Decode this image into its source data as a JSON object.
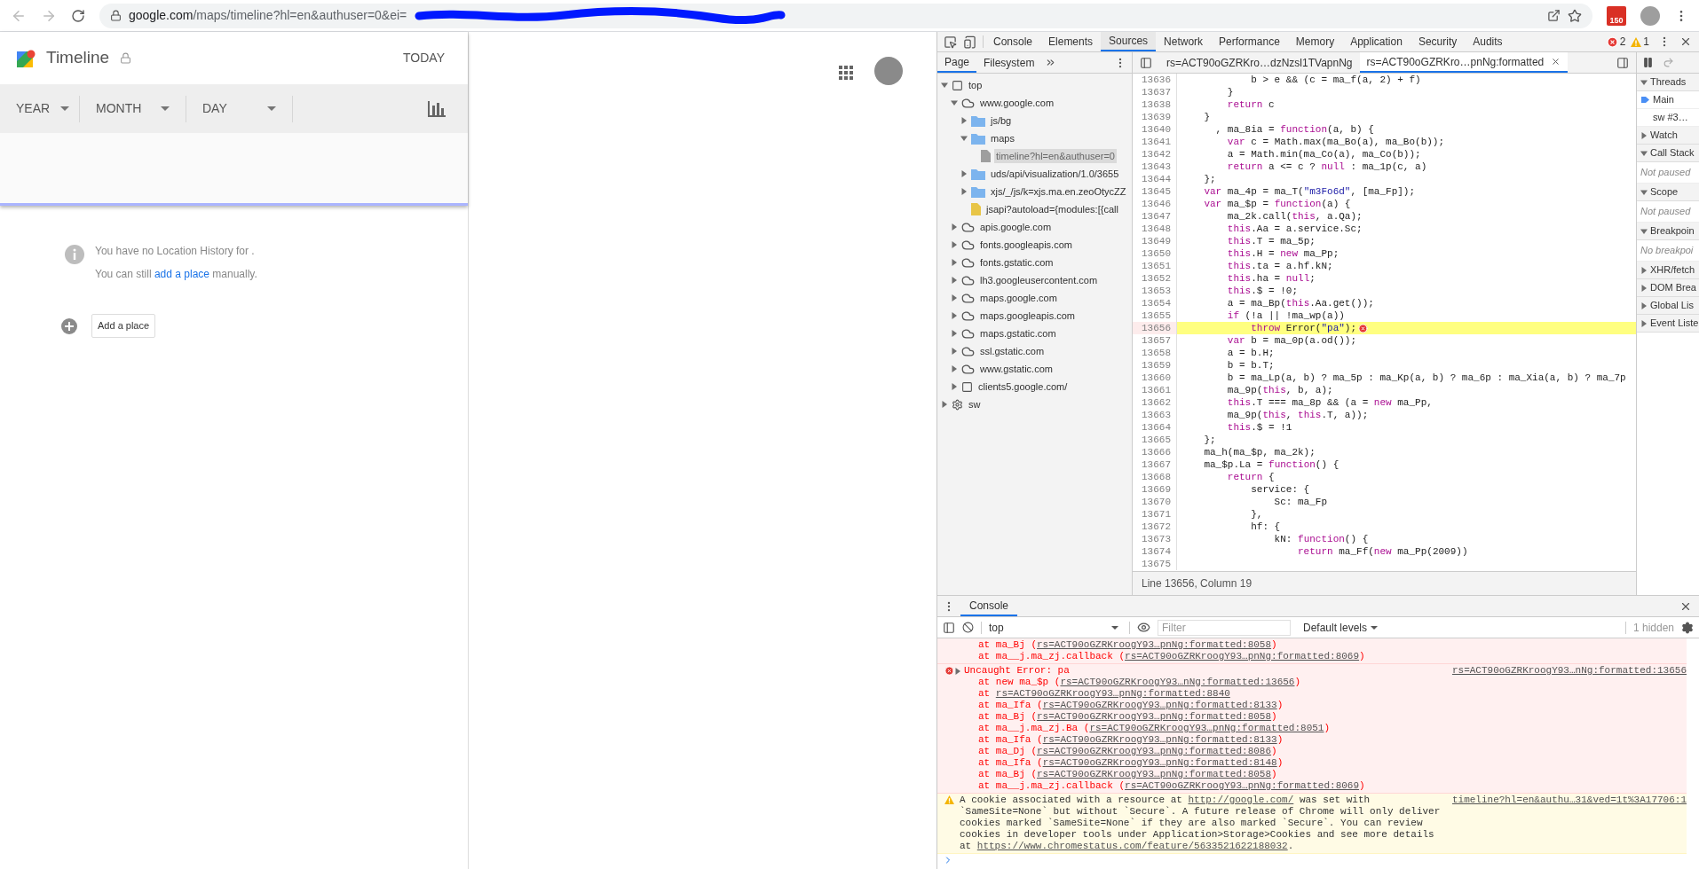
{
  "browser": {
    "url_host": "google.com",
    "url_path": "/maps/timeline?hl=en&authuser=0&ei=",
    "extension_badge": "150"
  },
  "timeline": {
    "title": "Timeline",
    "today_button": "TODAY",
    "filters": [
      {
        "label": "YEAR"
      },
      {
        "label": "MONTH"
      },
      {
        "label": "DAY"
      }
    ],
    "empty_message": "You have no Location History for .",
    "hint": {
      "before": "You can still ",
      "link": "add a place",
      "after": " manually."
    },
    "add_button": "Add a place"
  },
  "devtools": {
    "tabs": [
      {
        "label": "Console",
        "selected": false
      },
      {
        "label": "Elements",
        "selected": false
      },
      {
        "label": "Sources",
        "selected": true
      },
      {
        "label": "Network",
        "selected": false
      },
      {
        "label": "Performance",
        "selected": false
      },
      {
        "label": "Memory",
        "selected": false
      },
      {
        "label": "Application",
        "selected": false
      },
      {
        "label": "Security",
        "selected": false
      },
      {
        "label": "Audits",
        "selected": false
      }
    ],
    "error_count": "2",
    "warning_count": "1",
    "sources": {
      "navigator_tabs": [
        {
          "label": "Page",
          "selected": true
        },
        {
          "label": "Filesystem",
          "selected": false
        }
      ],
      "tree": [
        {
          "label": "top",
          "kind": "frame",
          "expanded": true,
          "selected": false,
          "children": [
            {
              "label": "www.google.com",
              "kind": "cloud",
              "expanded": true,
              "selected": false,
              "children": [
                {
                  "label": "js/bg",
                  "kind": "folder",
                  "expanded": false,
                  "selected": false
                },
                {
                  "label": "maps",
                  "kind": "folder",
                  "expanded": true,
                  "selected": false,
                  "children": [
                    {
                      "label": "timeline?hl=en&authuser=0",
                      "kind": "document",
                      "selected": true
                    }
                  ]
                },
                {
                  "label": "uds/api/visualization/1.0/3655",
                  "kind": "folder",
                  "expanded": false,
                  "selected": false
                },
                {
                  "label": "xjs/_/js/k=xjs.ma.en.zeoOtycZZ",
                  "kind": "folder",
                  "expanded": false,
                  "selected": false
                },
                {
                  "label": "jsapi?autoload={modules:[{call",
                  "kind": "script",
                  "selected": false
                }
              ]
            },
            {
              "label": "apis.google.com",
              "kind": "cloud",
              "expanded": false,
              "selected": false
            },
            {
              "label": "fonts.googleapis.com",
              "kind": "cloud",
              "expanded": false,
              "selected": false
            },
            {
              "label": "fonts.gstatic.com",
              "kind": "cloud",
              "expanded": false,
              "selected": false
            },
            {
              "label": "lh3.googleusercontent.com",
              "kind": "cloud",
              "expanded": false,
              "selected": false
            },
            {
              "label": "maps.google.com",
              "kind": "cloud",
              "expanded": false,
              "selected": false
            },
            {
              "label": "maps.googleapis.com",
              "kind": "cloud",
              "expanded": false,
              "selected": false
            },
            {
              "label": "maps.gstatic.com",
              "kind": "cloud",
              "expanded": false,
              "selected": false
            },
            {
              "label": "ssl.gstatic.com",
              "kind": "cloud",
              "expanded": false,
              "selected": false
            },
            {
              "label": "www.gstatic.com",
              "kind": "cloud",
              "expanded": false,
              "selected": false
            },
            {
              "label": "clients5.google.com/",
              "kind": "frame",
              "expanded": false,
              "selected": false
            }
          ]
        },
        {
          "label": "sw",
          "kind": "gear",
          "expanded": false,
          "selected": false
        }
      ],
      "editor_tabs": [
        {
          "label": "rs=ACT90oGZRKro…dzNzsl1TVapnNg",
          "selected": false
        },
        {
          "label": "rs=ACT90oGZRKro…pnNg:formatted",
          "selected": true
        }
      ],
      "lines": [
        {
          "number": "13636",
          "highlighted": false,
          "tokens": [
            {
              "kind": "plain",
              "text": "            b > e && (c = ma_f(a, 2) + f)"
            }
          ]
        },
        {
          "number": "13637",
          "highlighted": false,
          "tokens": [
            {
              "kind": "plain",
              "text": "        }"
            }
          ]
        },
        {
          "number": "13638",
          "highlighted": false,
          "tokens": [
            {
              "kind": "keyword",
              "text": "        return"
            },
            {
              "kind": "plain",
              "text": " c"
            }
          ]
        },
        {
          "number": "13639",
          "highlighted": false,
          "tokens": [
            {
              "kind": "plain",
              "text": "    }"
            }
          ]
        },
        {
          "number": "13640",
          "highlighted": false,
          "tokens": [
            {
              "kind": "plain",
              "text": "      , ma_8ia = "
            },
            {
              "kind": "keyword",
              "text": "function"
            },
            {
              "kind": "plain",
              "text": "(a, b) {"
            }
          ]
        },
        {
          "number": "13641",
          "highlighted": false,
          "tokens": [
            {
              "kind": "keyword",
              "text": "        var"
            },
            {
              "kind": "plain",
              "text": " c = Math.max(ma_Bo(a), ma_Bo(b));"
            }
          ]
        },
        {
          "number": "13642",
          "highlighted": false,
          "tokens": [
            {
              "kind": "plain",
              "text": "        a = Math.min(ma_Co(a), ma_Co(b));"
            }
          ]
        },
        {
          "number": "13643",
          "highlighted": false,
          "tokens": [
            {
              "kind": "keyword",
              "text": "        return"
            },
            {
              "kind": "plain",
              "text": " a <= c ? "
            },
            {
              "kind": "keyword",
              "text": "null"
            },
            {
              "kind": "plain",
              "text": " : ma_1p(c, a)"
            }
          ]
        },
        {
          "number": "13644",
          "highlighted": false,
          "tokens": [
            {
              "kind": "plain",
              "text": "    };"
            }
          ]
        },
        {
          "number": "13645",
          "highlighted": false,
          "tokens": [
            {
              "kind": "keyword",
              "text": "    var"
            },
            {
              "kind": "plain",
              "text": " ma_4p = ma_T("
            },
            {
              "kind": "string",
              "text": "\"m3Fo6d\""
            },
            {
              "kind": "plain",
              "text": ", [ma_Fp]);"
            }
          ]
        },
        {
          "number": "13646",
          "highlighted": false,
          "tokens": [
            {
              "kind": "keyword",
              "text": "    var"
            },
            {
              "kind": "plain",
              "text": " ma_$p = "
            },
            {
              "kind": "keyword",
              "text": "function"
            },
            {
              "kind": "plain",
              "text": "(a) {"
            }
          ]
        },
        {
          "number": "13647",
          "highlighted": false,
          "tokens": [
            {
              "kind": "plain",
              "text": "        ma_2k.call("
            },
            {
              "kind": "keyword",
              "text": "this"
            },
            {
              "kind": "plain",
              "text": ", a.Qa);"
            }
          ]
        },
        {
          "number": "13648",
          "highlighted": false,
          "tokens": [
            {
              "kind": "keyword",
              "text": "        this"
            },
            {
              "kind": "plain",
              "text": ".Aa = a.service.Sc;"
            }
          ]
        },
        {
          "number": "13649",
          "highlighted": false,
          "tokens": [
            {
              "kind": "keyword",
              "text": "        this"
            },
            {
              "kind": "plain",
              "text": ".T = ma_5p;"
            }
          ]
        },
        {
          "number": "13650",
          "highlighted": false,
          "tokens": [
            {
              "kind": "keyword",
              "text": "        this"
            },
            {
              "kind": "plain",
              "text": ".H = "
            },
            {
              "kind": "keyword",
              "text": "new"
            },
            {
              "kind": "plain",
              "text": " ma_Pp;"
            }
          ]
        },
        {
          "number": "13651",
          "highlighted": false,
          "tokens": [
            {
              "kind": "keyword",
              "text": "        this"
            },
            {
              "kind": "plain",
              "text": ".ta = a.hf.kN;"
            }
          ]
        },
        {
          "number": "13652",
          "highlighted": false,
          "tokens": [
            {
              "kind": "keyword",
              "text": "        this"
            },
            {
              "kind": "plain",
              "text": ".ha = "
            },
            {
              "kind": "keyword",
              "text": "null"
            },
            {
              "kind": "plain",
              "text": ";"
            }
          ]
        },
        {
          "number": "13653",
          "highlighted": false,
          "tokens": [
            {
              "kind": "keyword",
              "text": "        this"
            },
            {
              "kind": "plain",
              "text": ".$ = !0;"
            }
          ]
        },
        {
          "number": "13654",
          "highlighted": false,
          "tokens": [
            {
              "kind": "plain",
              "text": "        a = ma_Bp("
            },
            {
              "kind": "keyword",
              "text": "this"
            },
            {
              "kind": "plain",
              "text": ".Aa.get());"
            }
          ]
        },
        {
          "number": "13655",
          "highlighted": false,
          "tokens": [
            {
              "kind": "keyword",
              "text": "        if"
            },
            {
              "kind": "plain",
              "text": " (!a || !ma_wp(a))"
            }
          ]
        },
        {
          "number": "13656",
          "highlighted": true,
          "tokens": [
            {
              "kind": "keyword",
              "text": "            throw"
            },
            {
              "kind": "plain",
              "text": " Error("
            },
            {
              "kind": "string",
              "text": "\"pa\""
            },
            {
              "kind": "plain",
              "text": ");"
            }
          ]
        },
        {
          "number": "13657",
          "highlighted": false,
          "tokens": [
            {
              "kind": "keyword",
              "text": "        var"
            },
            {
              "kind": "plain",
              "text": " b = ma_0p(a.od());"
            }
          ]
        },
        {
          "number": "13658",
          "highlighted": false,
          "tokens": [
            {
              "kind": "plain",
              "text": "        a = b.H;"
            }
          ]
        },
        {
          "number": "13659",
          "highlighted": false,
          "tokens": [
            {
              "kind": "plain",
              "text": "        b = b.T;"
            }
          ]
        },
        {
          "number": "13660",
          "highlighted": false,
          "tokens": [
            {
              "kind": "plain",
              "text": "        b = ma_Lp(a, b) ? ma_5p : ma_Kp(a, b) ? ma_6p : ma_Xia(a, b) ? ma_7p"
            }
          ]
        },
        {
          "number": "13661",
          "highlighted": false,
          "tokens": [
            {
              "kind": "plain",
              "text": "        ma_9p("
            },
            {
              "kind": "keyword",
              "text": "this"
            },
            {
              "kind": "plain",
              "text": ", b, a);"
            }
          ]
        },
        {
          "number": "13662",
          "highlighted": false,
          "tokens": [
            {
              "kind": "keyword",
              "text": "        this"
            },
            {
              "kind": "plain",
              "text": ".T === ma_8p && (a = "
            },
            {
              "kind": "keyword",
              "text": "new"
            },
            {
              "kind": "plain",
              "text": " ma_Pp,"
            }
          ]
        },
        {
          "number": "13663",
          "highlighted": false,
          "tokens": [
            {
              "kind": "plain",
              "text": "        ma_9p("
            },
            {
              "kind": "keyword",
              "text": "this"
            },
            {
              "kind": "plain",
              "text": ", "
            },
            {
              "kind": "keyword",
              "text": "this"
            },
            {
              "kind": "plain",
              "text": ".T, a));"
            }
          ]
        },
        {
          "number": "13664",
          "highlighted": false,
          "tokens": [
            {
              "kind": "keyword",
              "text": "        this"
            },
            {
              "kind": "plain",
              "text": ".$ = !1"
            }
          ]
        },
        {
          "number": "13665",
          "highlighted": false,
          "tokens": [
            {
              "kind": "plain",
              "text": "    };"
            }
          ]
        },
        {
          "number": "13666",
          "highlighted": false,
          "tokens": [
            {
              "kind": "plain",
              "text": "    ma_h(ma_$p, ma_2k);"
            }
          ]
        },
        {
          "number": "13667",
          "highlighted": false,
          "tokens": [
            {
              "kind": "plain",
              "text": "    ma_$p.La = "
            },
            {
              "kind": "keyword",
              "text": "function"
            },
            {
              "kind": "plain",
              "text": "() {"
            }
          ]
        },
        {
          "number": "13668",
          "highlighted": false,
          "tokens": [
            {
              "kind": "keyword",
              "text": "        return"
            },
            {
              "kind": "plain",
              "text": " {"
            }
          ]
        },
        {
          "number": "13669",
          "highlighted": false,
          "tokens": [
            {
              "kind": "plain",
              "text": "            service: {"
            }
          ]
        },
        {
          "number": "13670",
          "highlighted": false,
          "tokens": [
            {
              "kind": "plain",
              "text": "                Sc: ma_Fp"
            }
          ]
        },
        {
          "number": "13671",
          "highlighted": false,
          "tokens": [
            {
              "kind": "plain",
              "text": "            },"
            }
          ]
        },
        {
          "number": "13672",
          "highlighted": false,
          "tokens": [
            {
              "kind": "plain",
              "text": "            hf: {"
            }
          ]
        },
        {
          "number": "13673",
          "highlighted": false,
          "tokens": [
            {
              "kind": "plain",
              "text": "                kN: "
            },
            {
              "kind": "keyword",
              "text": "function"
            },
            {
              "kind": "plain",
              "text": "() {"
            }
          ]
        },
        {
          "number": "13674",
          "highlighted": false,
          "tokens": [
            {
              "kind": "keyword",
              "text": "                    return"
            },
            {
              "kind": "plain",
              "text": " ma_Ff("
            },
            {
              "kind": "keyword",
              "text": "new"
            },
            {
              "kind": "plain",
              "text": " ma_Pp(2009))"
            }
          ]
        },
        {
          "number": "13675",
          "highlighted": false
        }
      ],
      "status": "Line 13656, Column 19",
      "debugger": [
        {
          "title": "Threads",
          "expanded": true,
          "threads": [
            {
              "label": "Main",
              "selected": true
            },
            {
              "label": "sw #3…",
              "selected": false
            }
          ]
        },
        {
          "title": "Watch",
          "expanded": false
        },
        {
          "title": "Call Stack",
          "expanded": true,
          "message": "Not paused"
        },
        {
          "title": "Scope",
          "expanded": true,
          "message": "Not paused"
        },
        {
          "title": "Breakpoin",
          "expanded": true,
          "message": "No breakpoi"
        },
        {
          "title": "XHR/fetch",
          "expanded": false
        },
        {
          "title": "DOM Brea",
          "expanded": false
        },
        {
          "title": "Global Lis",
          "expanded": false
        },
        {
          "title": "Event Liste",
          "expanded": false
        }
      ]
    },
    "console": {
      "tabs": [
        {
          "label": "Console",
          "selected": true
        }
      ],
      "context": "top",
      "filter_placeholder": "Filter",
      "levels": "Default levels",
      "hidden": "1 hidden",
      "messages": [
        {
          "kind": "error-tail",
          "frames": [
            {
              "prefix": "at ma_Bj (",
              "link": "rs=ACT90oGZRKroogY93…pnNg:formatted:8058",
              "suffix": ")"
            },
            {
              "prefix": "at ma__j.ma_zj.callback (",
              "link": "rs=ACT90oGZRKroogY93…pnNg:formatted:8069",
              "suffix": ")"
            }
          ]
        },
        {
          "kind": "error",
          "text": "Uncaught Error: pa",
          "source": "rs=ACT90oGZRKroogY93…nNg:formatted:13656",
          "frames": [
            {
              "prefix": "at new ma_$p (",
              "link": "rs=ACT90oGZRKroogY93…nNg:formatted:13656",
              "suffix": ")"
            },
            {
              "prefix": "at ",
              "link": "rs=ACT90oGZRKroogY93…pnNg:formatted:8840"
            },
            {
              "prefix": "at ma_Ifa (",
              "link": "rs=ACT90oGZRKroogY93…pnNg:formatted:8133",
              "suffix": ")"
            },
            {
              "prefix": "at ma_Bj (",
              "link": "rs=ACT90oGZRKroogY93…pnNg:formatted:8058",
              "suffix": ")"
            },
            {
              "prefix": "at ma__j.ma_zj.Ba (",
              "link": "rs=ACT90oGZRKroogY93…pnNg:formatted:8051",
              "suffix": ")"
            },
            {
              "prefix": "at ma_Ifa (",
              "link": "rs=ACT90oGZRKroogY93…pnNg:formatted:8133",
              "suffix": ")"
            },
            {
              "prefix": "at ma_Dj (",
              "link": "rs=ACT90oGZRKroogY93…pnNg:formatted:8086",
              "suffix": ")"
            },
            {
              "prefix": "at ma_Ifa (",
              "link": "rs=ACT90oGZRKroogY93…pnNg:formatted:8148",
              "suffix": ")"
            },
            {
              "prefix": "at ma_Bj (",
              "link": "rs=ACT90oGZRKroogY93…pnNg:formatted:8058",
              "suffix": ")"
            },
            {
              "prefix": "at ma__j.ma_zj.callback (",
              "link": "rs=ACT90oGZRKroogY93…pnNg:formatted:8069",
              "suffix": ")"
            }
          ]
        },
        {
          "kind": "warning",
          "source": "timeline?hl=en&authu…31&ved=1t%3A17706:1",
          "parts": [
            {
              "kind": "text",
              "text": "A cookie associated with a resource at "
            },
            {
              "kind": "link",
              "text": "http://google.com/"
            },
            {
              "kind": "text",
              "text": " was set with `SameSite=None` but without `Secure`. A future release of Chrome will only deliver cookies marked `SameSite=None` if they are also marked `Secure`. You can review cookies in developer tools under Application>Storage>Cookies and see more details at "
            },
            {
              "kind": "link",
              "text": "https://www.chromestatus.com/feature/5633521622188032"
            },
            {
              "kind": "text",
              "text": "."
            }
          ]
        }
      ]
    }
  }
}
